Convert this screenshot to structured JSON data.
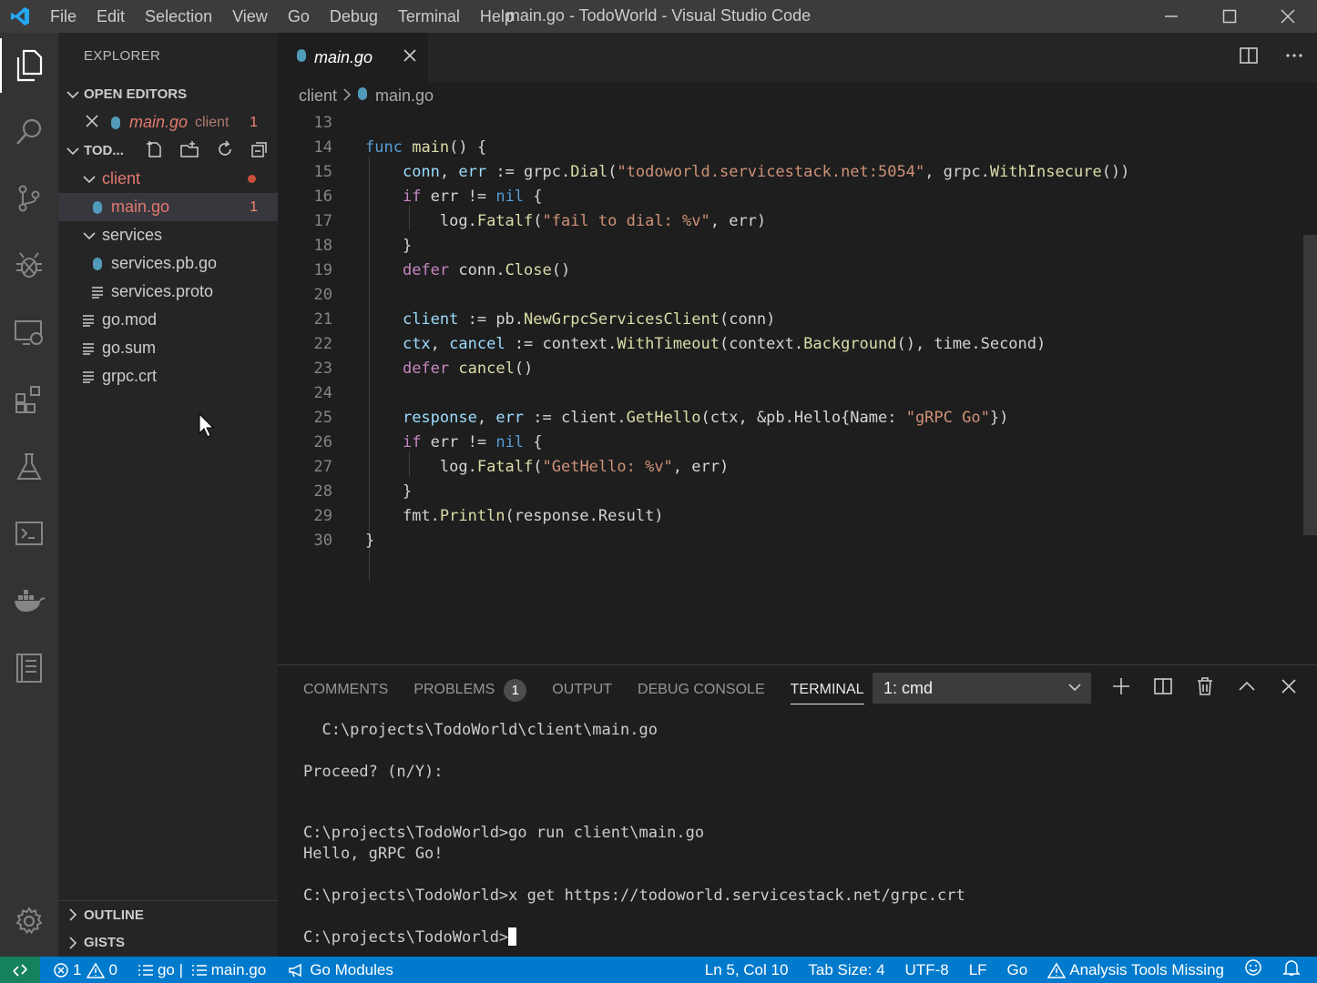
{
  "window": {
    "title": "main.go - TodoWorld - Visual Studio Code"
  },
  "menu": [
    "File",
    "Edit",
    "Selection",
    "View",
    "Go",
    "Debug",
    "Terminal",
    "Help"
  ],
  "explorer": {
    "header": "EXPLORER",
    "open_editors_label": "OPEN EDITORS",
    "open_editor": {
      "name": "main.go",
      "folder": "client",
      "problems": "1"
    },
    "workspace_label": "TOD...",
    "tree": [
      {
        "name": "client",
        "kind": "folder",
        "color": "#e2796e"
      },
      {
        "name": "main.go",
        "kind": "go-file",
        "problems": "1",
        "color": "#e2796e"
      },
      {
        "name": "services",
        "kind": "folder"
      },
      {
        "name": "services.pb.go",
        "kind": "go-file"
      },
      {
        "name": "services.proto",
        "kind": "text-file"
      },
      {
        "name": "go.mod",
        "kind": "text-file"
      },
      {
        "name": "go.sum",
        "kind": "text-file"
      },
      {
        "name": "grpc.crt",
        "kind": "text-file"
      }
    ],
    "outline_label": "OUTLINE",
    "gists_label": "GISTS"
  },
  "editor": {
    "tab_name": "main.go",
    "breadcrumb": [
      "client",
      "main.go"
    ],
    "line_numbers": [
      "13",
      "14",
      "15",
      "16",
      "17",
      "18",
      "19",
      "20",
      "21",
      "22",
      "23",
      "24",
      "25",
      "26",
      "27",
      "28",
      "29",
      "30"
    ]
  },
  "panel": {
    "tabs": [
      "COMMENTS",
      "PROBLEMS",
      "OUTPUT",
      "DEBUG CONSOLE",
      "TERMINAL"
    ],
    "problems_count": "1",
    "terminal_select": "1: cmd",
    "terminal_lines": [
      "  C:\\projects\\TodoWorld\\client\\main.go",
      "",
      "Proceed? (n/Y):",
      "",
      "",
      "C:\\projects\\TodoWorld>go run client\\main.go",
      "Hello, gRPC Go!",
      "",
      "C:\\projects\\TodoWorld>x get https://todoworld.servicestack.net/grpc.crt",
      "",
      "C:\\projects\\TodoWorld>"
    ]
  },
  "status": {
    "errors": "1",
    "warnings": "0",
    "go": "go | ",
    "file": "main.go",
    "modules": "Go Modules",
    "position": "Ln 5, Col 10",
    "tab_size": "Tab Size: 4",
    "encoding": "UTF-8",
    "eol": "LF",
    "language": "Go",
    "analysis": "Analysis Tools Missing"
  },
  "colors": {
    "accent": "#007acc",
    "remote": "#16825d",
    "error": "#e2796e"
  }
}
